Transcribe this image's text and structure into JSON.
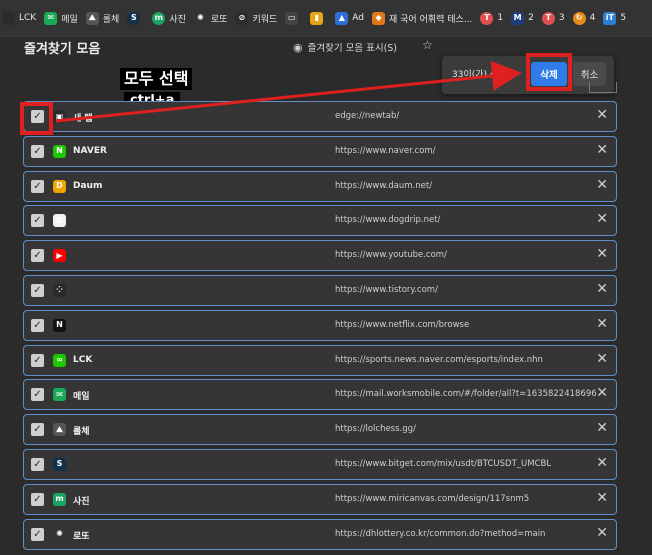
{
  "bookmark_bar": [
    {
      "label": "LCK",
      "icon": "lck-icon",
      "glyph": "",
      "bg": "#2b2b2b"
    },
    {
      "label": "메일",
      "icon": "mail-icon",
      "glyph": "✉",
      "bg": "#1aaa55"
    },
    {
      "label": "롤체",
      "icon": "lolchess-icon",
      "glyph": "⛰",
      "bg": "#555555"
    },
    {
      "label": "",
      "icon": "bitget-icon",
      "glyph": "S",
      "bg": "#123049"
    },
    {
      "label": "사진",
      "icon": "miricanvas-icon",
      "glyph": "m",
      "bg": "#1aa463"
    },
    {
      "label": "로또",
      "icon": "lotto-icon",
      "glyph": "✺",
      "bg": "#333333"
    },
    {
      "label": "키워드",
      "icon": "keyword-icon",
      "glyph": "⊘",
      "bg": "#2c2c2c"
    },
    {
      "label": "",
      "icon": "car-icon",
      "glyph": "▭",
      "bg": "#444444"
    },
    {
      "label": "",
      "icon": "analytics-icon",
      "glyph": "▮",
      "bg": "#e8a317"
    },
    {
      "label": "Ad",
      "icon": "google-ads-icon",
      "glyph": "▲",
      "bg": "#2f6fd6"
    },
    {
      "label": "재 국어 어휘력 테스...",
      "icon": "metamask-icon",
      "glyph": "◆",
      "bg": "#e2761b"
    },
    {
      "label": "1",
      "icon": "t-icon",
      "glyph": "T",
      "bg": "#e05050"
    },
    {
      "label": "2",
      "icon": "m-icon",
      "glyph": "M",
      "bg": "#1d3e7a"
    },
    {
      "label": "3",
      "icon": "t-icon",
      "glyph": "T",
      "bg": "#e05050"
    },
    {
      "label": "4",
      "icon": "orange-icon",
      "glyph": "↻",
      "bg": "#e88a1a"
    },
    {
      "label": "5",
      "icon": "it-icon",
      "glyph": "iT",
      "bg": "#2d7fd6"
    }
  ],
  "page_title": "즐겨찾기 모음",
  "show_bar_label": "즐겨찾기 모음 표시(S)",
  "selection": {
    "count_text": "33이(가) 선택됨",
    "delete_label": "삭제",
    "cancel_label": "취소"
  },
  "callout": {
    "title": "모두 선택",
    "shortcut": "ctrl+a"
  },
  "bookmarks": [
    {
      "name": "새 탭",
      "url": "edge://newtab/",
      "icon": "newtab-icon",
      "glyph": "▣",
      "bg": "#2b2b2b"
    },
    {
      "name": "NAVER",
      "url": "https://www.naver.com/",
      "icon": "naver-icon",
      "glyph": "N",
      "bg": "#1ec800"
    },
    {
      "name": "Daum",
      "url": "https://www.daum.net/",
      "icon": "daum-icon",
      "glyph": "D",
      "bg": "#f0a500"
    },
    {
      "name": "",
      "url": "https://www.dogdrip.net/",
      "icon": "dogdrip-icon",
      "glyph": "D",
      "bg": "#f2f2f2"
    },
    {
      "name": "",
      "url": "https://www.youtube.com/",
      "icon": "youtube-icon",
      "glyph": "▶",
      "bg": "#ff0000"
    },
    {
      "name": "",
      "url": "https://www.tistory.com/",
      "icon": "tistory-icon",
      "glyph": "⁘",
      "bg": "#2b2b2b"
    },
    {
      "name": "",
      "url": "https://www.netflix.com/browse",
      "icon": "netflix-icon",
      "glyph": "N",
      "bg": "#111111"
    },
    {
      "name": "LCK",
      "url": "https://sports.news.naver.com/esports/index.nhn",
      "icon": "naver-esports-icon",
      "glyph": "∞",
      "bg": "#1ec800"
    },
    {
      "name": "메일",
      "url": "https://mail.worksmobile.com/#/folder/all?t=1635822418696",
      "icon": "mail-icon",
      "glyph": "✉",
      "bg": "#1aaa55"
    },
    {
      "name": "롤체",
      "url": "https://lolchess.gg/",
      "icon": "lolchess-icon",
      "glyph": "⛰",
      "bg": "#555555"
    },
    {
      "name": "",
      "url": "https://www.bitget.com/mix/usdt/BTCUSDT_UMCBL",
      "icon": "bitget-icon",
      "glyph": "S",
      "bg": "#123049"
    },
    {
      "name": "사진",
      "url": "https://www.miricanvas.com/design/117snm5",
      "icon": "miricanvas-icon",
      "glyph": "m",
      "bg": "#1aa463"
    },
    {
      "name": "로또",
      "url": "https://dhlottery.co.kr/common.do?method=main",
      "icon": "lotto-icon",
      "glyph": "✺",
      "bg": "#333333"
    }
  ],
  "colors": {
    "accent": "#2f7be8",
    "highlight": "#e02020",
    "row_border": "#5f8fc4"
  }
}
